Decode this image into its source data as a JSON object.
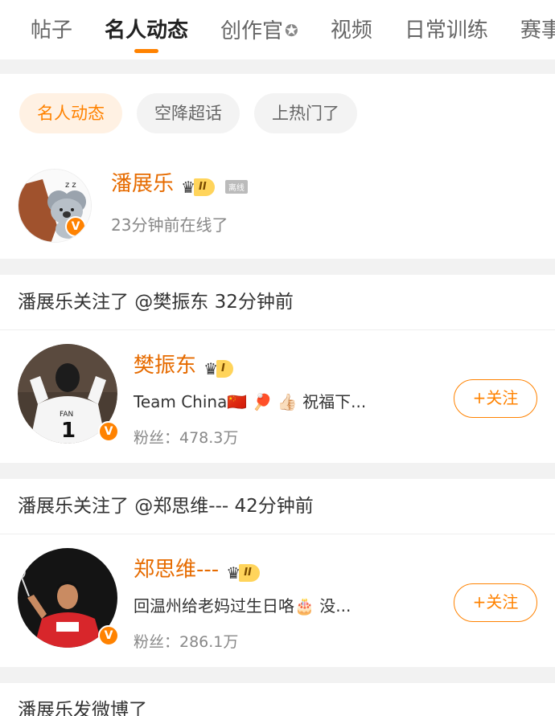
{
  "tabs": [
    {
      "label": "帖子"
    },
    {
      "label": "名人动态"
    },
    {
      "label": "创作官"
    },
    {
      "label": "视频"
    },
    {
      "label": "日常训练"
    },
    {
      "label": "赛事"
    }
  ],
  "active_tab": "名人动态",
  "chips": [
    {
      "label": "名人动态"
    },
    {
      "label": "空降超话"
    },
    {
      "label": "上热门了"
    }
  ],
  "profile": {
    "name": "潘展乐",
    "vip_level": "II",
    "status_badge": "离线",
    "online_text": "23分钟前在线了"
  },
  "feed": [
    {
      "header": "潘展乐关注了 @樊振东 32分钟前",
      "name": "樊振东",
      "vip_level": "I",
      "desc": "Team China🇨🇳 🏓 👍🏻  祝福下...",
      "fans": "粉丝：478.3万",
      "follow_label": "+关注"
    },
    {
      "header": "潘展乐关注了 @郑思维--- 42分钟前",
      "name": "郑思维---",
      "vip_level": "II",
      "desc": "回温州给老妈过生日咯🎂 没...",
      "fans": "粉丝：286.1万",
      "follow_label": "+关注"
    }
  ],
  "next_header": "潘展乐发微博了",
  "colors": {
    "accent": "#ff8200",
    "name_orange": "#e66b00",
    "chip_active_bg": "#fff1e3",
    "background": "#f2f2f2"
  }
}
